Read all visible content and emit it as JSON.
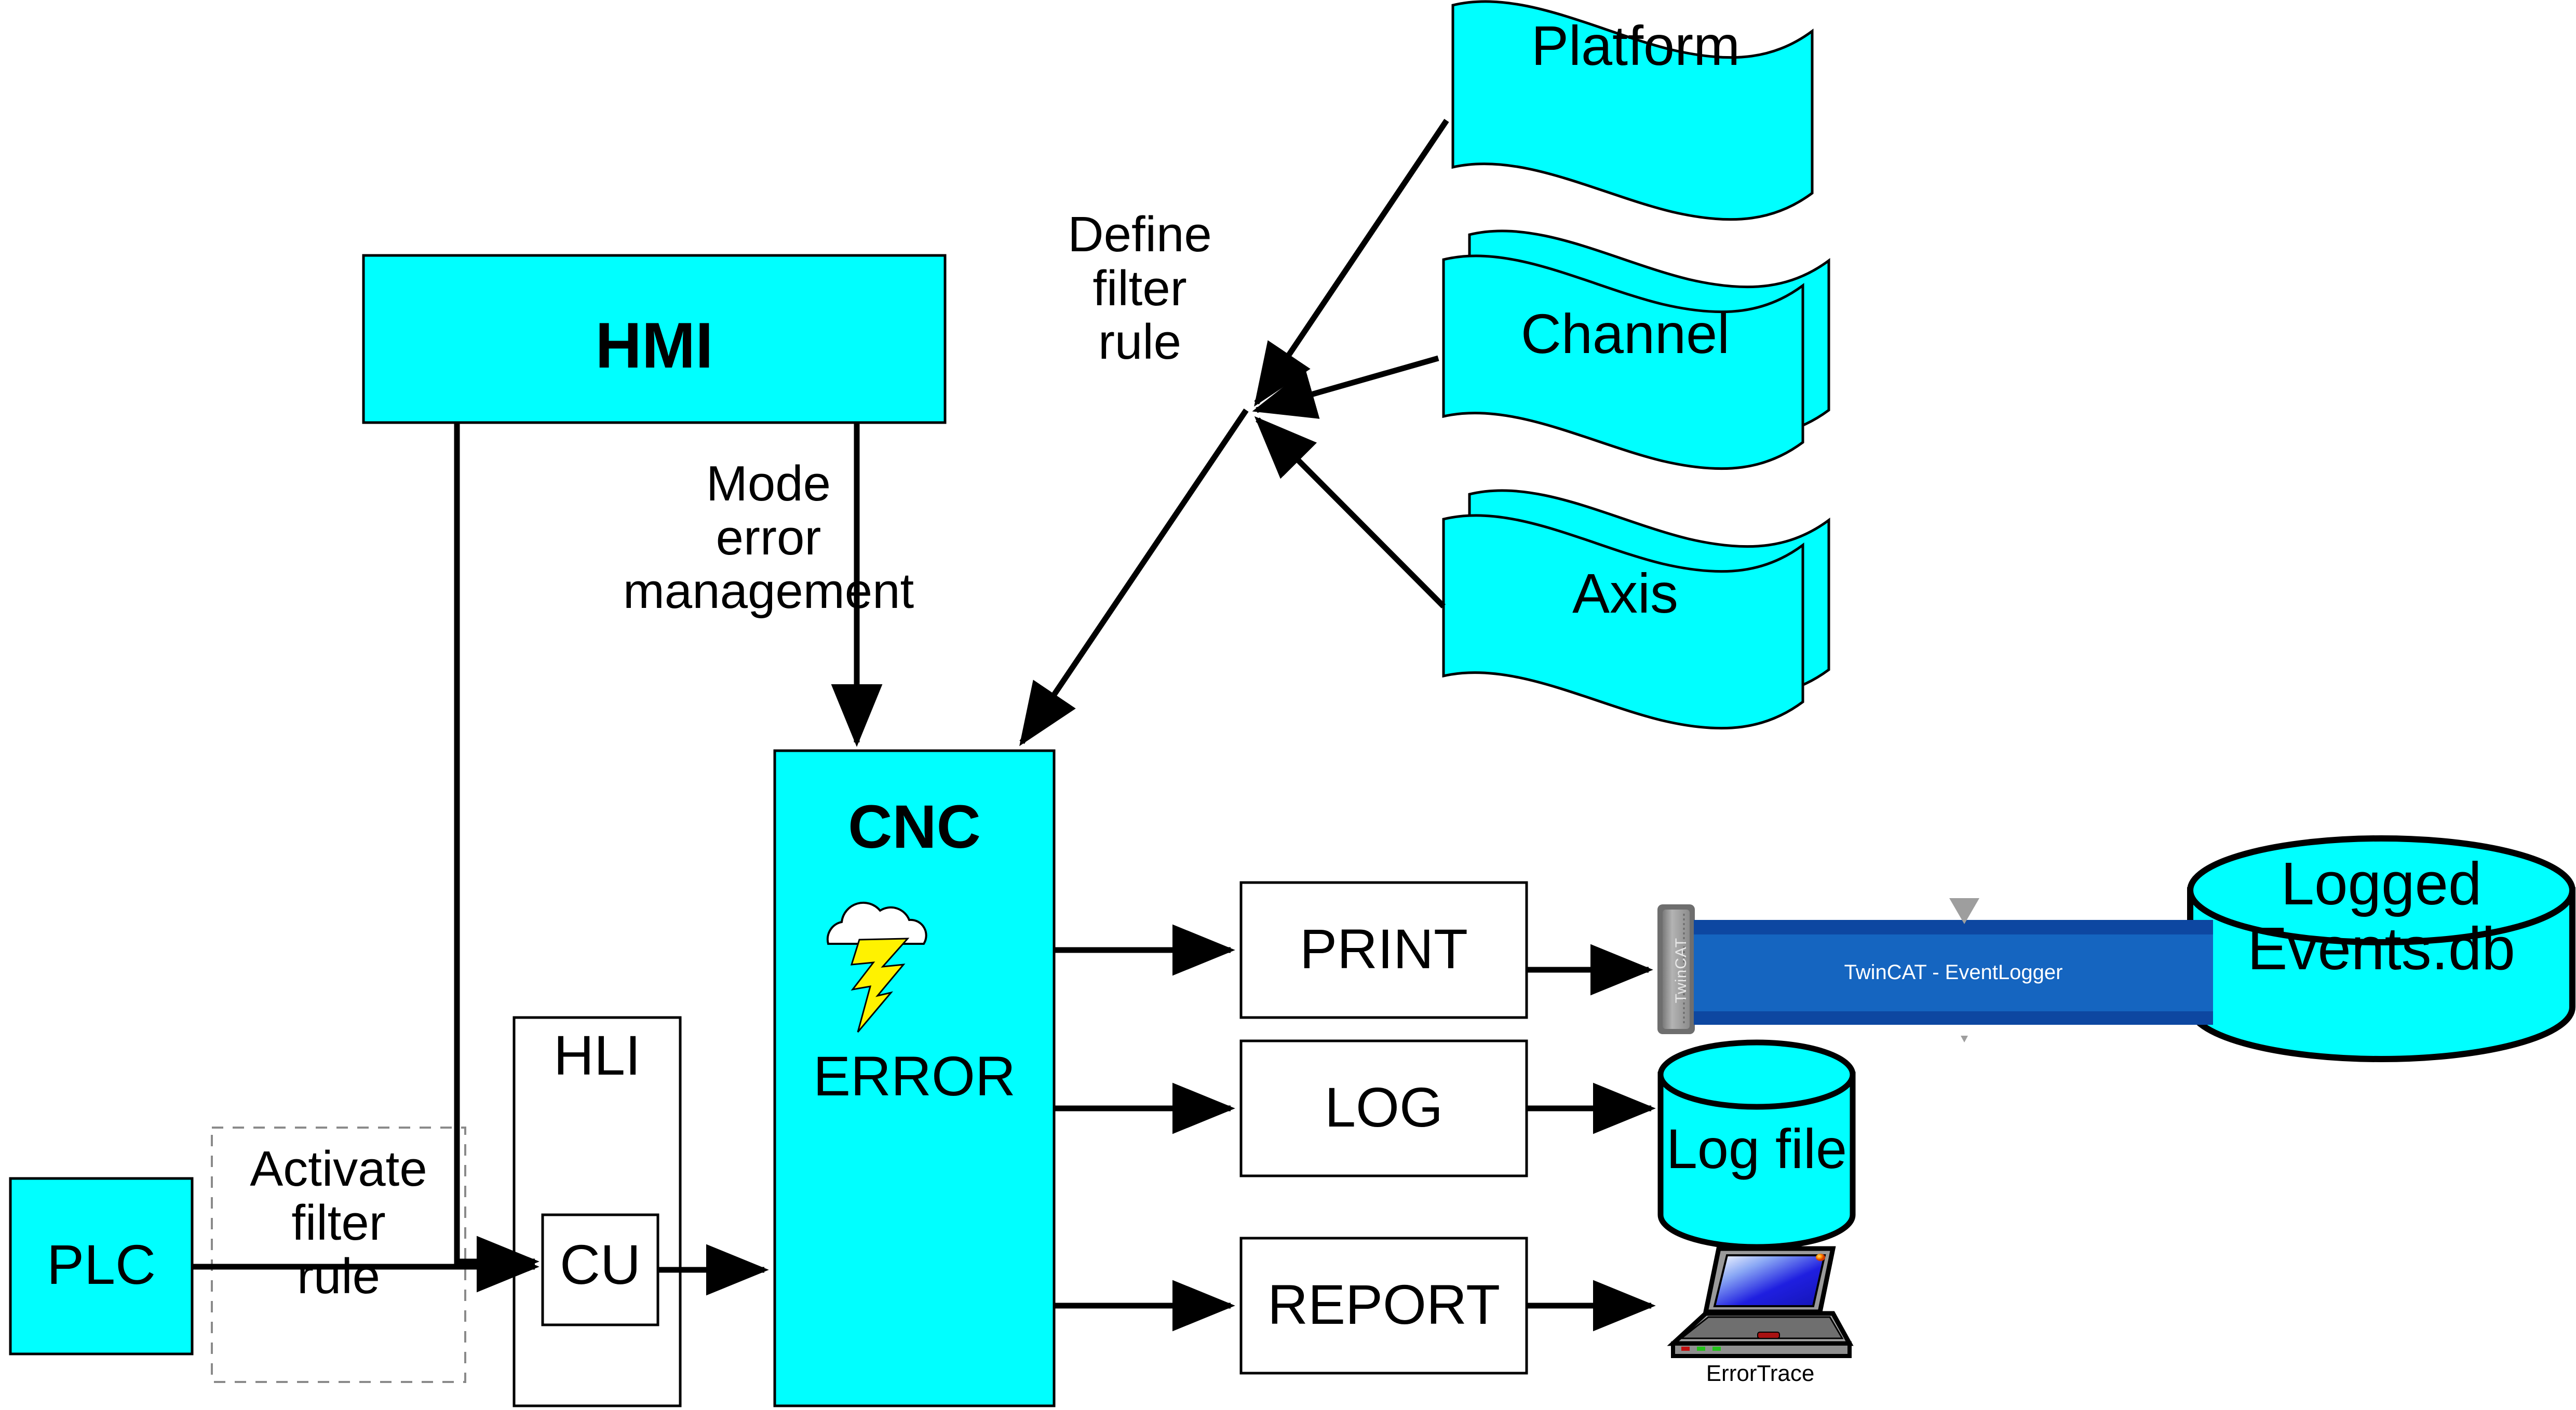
{
  "diagram": {
    "title": "CNC error handling and filter rule data flow",
    "colors": {
      "node_fill": "#00FFFF",
      "node_stroke": "#000000",
      "plain_box_fill": "#FFFFFF",
      "eventlogger_fill": "#1565C0",
      "eventlogger_border": "#0D47A1",
      "eventlogger_tab": "#808080",
      "bolt": "#FFF200",
      "cloud": "#FFFFFF",
      "background": "#FFFFFF"
    },
    "nodes": {
      "hmi": {
        "label": "HMI",
        "shape": "rectangle",
        "fill": "#00FFFF"
      },
      "cnc": {
        "label": "CNC",
        "shape": "rectangle",
        "fill": "#00FFFF"
      },
      "cnc_error": {
        "label": "ERROR",
        "icon": "storm-cloud-lightning-icon"
      },
      "hli": {
        "label": "HLI",
        "shape": "rectangle",
        "fill": "#FFFFFF"
      },
      "cu": {
        "label": "CU",
        "shape": "rectangle",
        "fill": "#FFFFFF"
      },
      "plc": {
        "label": "PLC",
        "shape": "rectangle",
        "fill": "#00FFFF"
      },
      "platform": {
        "label": "Platform",
        "shape": "wave-document",
        "fill": "#00FFFF"
      },
      "channel": {
        "label": "Channel",
        "shape": "wave-document",
        "fill": "#00FFFF"
      },
      "axis": {
        "label": "Axis",
        "shape": "wave-document",
        "fill": "#00FFFF"
      },
      "print": {
        "label": "PRINT",
        "shape": "rectangle",
        "fill": "#FFFFFF"
      },
      "log": {
        "label": "LOG",
        "shape": "rectangle",
        "fill": "#FFFFFF"
      },
      "report": {
        "label": "REPORT",
        "shape": "rectangle",
        "fill": "#FFFFFF"
      },
      "log_file": {
        "label": "Log file",
        "shape": "cylinder",
        "fill": "#00FFFF"
      },
      "logged_events_db": {
        "label": "Logged\nEvents.db",
        "shape": "cylinder",
        "fill": "#00FFFF"
      },
      "event_logger": {
        "label": "TwinCAT - EventLogger",
        "tab_label": "TwinCAT",
        "shape": "banner",
        "fill": "#1565C0"
      },
      "error_trace": {
        "label": "ErrorTrace",
        "shape": "laptop-icon"
      }
    },
    "edge_labels": {
      "define_filter_rule": "Define\nfilter\nrule",
      "mode_error_management": "Mode\nerror\nmanagement",
      "activate_filter_rule": "Activate\nfilter\nrule"
    }
  }
}
